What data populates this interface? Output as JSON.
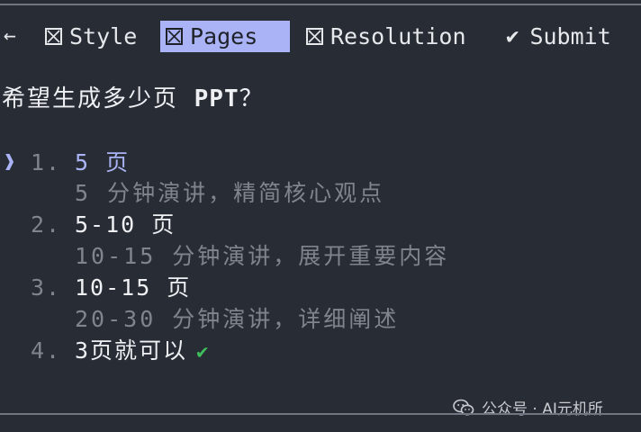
{
  "tabs": {
    "back_glyph": "←",
    "style": "Style",
    "pages": "Pages",
    "resolution": "Resolution",
    "submit_glyph": "✔",
    "submit": "Submit"
  },
  "question": {
    "prefix": "希望生成多少页 ",
    "bold": "PPT",
    "suffix": "？"
  },
  "options": [
    {
      "num": "1.",
      "label": "5 页",
      "desc": "5 分钟演讲，精简核心观点"
    },
    {
      "num": "2.",
      "label": "5-10 页",
      "desc": "10-15 分钟演讲，展开重要内容"
    },
    {
      "num": "3.",
      "label": "10-15 页",
      "desc": "20-30 分钟演讲，详细阐述"
    },
    {
      "num": "4.",
      "label": "3页就可以"
    }
  ],
  "pointer_glyph": "❱",
  "custom_check_glyph": "✔",
  "watermark": "公众号 · AI元机所",
  "colors": {
    "background": "#282c34",
    "accent": "#a9b3f5",
    "muted": "#7f848e",
    "success": "#3fbf5a"
  }
}
